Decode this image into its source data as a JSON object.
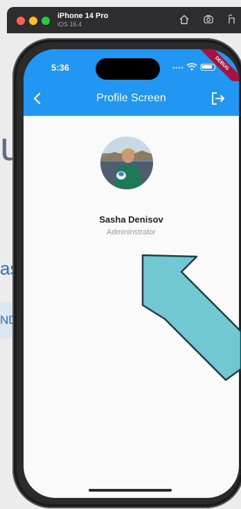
{
  "simulator": {
    "device_name": "iPhone 14 Pro",
    "os_version": "iOS 16.4"
  },
  "status_bar": {
    "time": "5:36",
    "debug_banner": "DEBUG"
  },
  "app_bar": {
    "title": "Profile Screen",
    "back_icon": "chevron-left-icon",
    "logout_icon": "logout-icon"
  },
  "profile": {
    "name": "Sasha Denisov",
    "role": "Admininstrator"
  },
  "background_fragments": {
    "large": "u",
    "mid": "as",
    "chip": "ND"
  },
  "colors": {
    "primary": "#2196f3",
    "annotation_arrow": "#72c8d2",
    "debug_banner": "#a8123e"
  }
}
